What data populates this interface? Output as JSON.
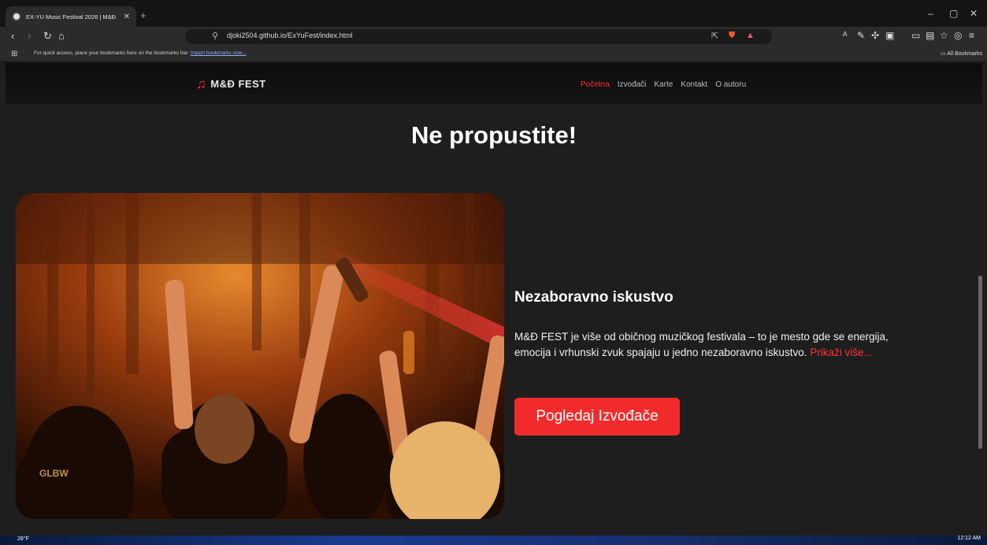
{
  "browser": {
    "tab_title": "EX-YU Music Festival 2026 | M&Đ",
    "new_tab": "+",
    "url": "djoki2504.github.io/ExYuFest/index.html",
    "bookmarks_message": "For quick access, place your bookmarks here on the bookmarks bar.",
    "import_bookmarks": "Import bookmarks now...",
    "all_bookmarks": "All Bookmarks"
  },
  "site": {
    "logo_text": "M&Đ FEST",
    "nav": [
      {
        "label": "Početna",
        "active": true
      },
      {
        "label": "Izvođači"
      },
      {
        "label": "Karte"
      },
      {
        "label": "Kontakt"
      },
      {
        "label": "O autoru"
      }
    ],
    "headline": "Ne propustite!",
    "card_title": "Nezaboravno iskustvo",
    "card_text": "M&Đ FEST je više od običnog muzičkog festivala – to je mesto gde se energija, emocija i vrhunski zvuk spajaju u jedno nezaboravno iskustvo.",
    "more_link": "Prikaži više...",
    "cta_label": "Pogledaj Izvođače"
  },
  "taskbar": {
    "weather": "28°F",
    "clock": "12:12 AM"
  },
  "colors": {
    "accent": "#f12b2b",
    "background": "#1e1e1e"
  }
}
